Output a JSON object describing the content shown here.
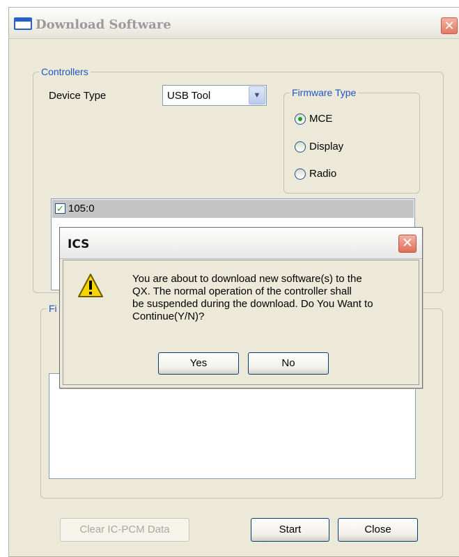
{
  "main_window": {
    "title": "Download Software",
    "close_glyph": "✕"
  },
  "controllers": {
    "legend": "Controllers",
    "device_type_label": "Device Type",
    "device_type_value": "USB Tool",
    "dropdown_glyph": "▼"
  },
  "firmware_type": {
    "legend": "Firmware Type",
    "options": [
      {
        "label": "MCE",
        "selected": true
      },
      {
        "label": "Display",
        "selected": false
      },
      {
        "label": "Radio",
        "selected": false
      }
    ]
  },
  "controller_list": {
    "items": [
      {
        "label": "105:0",
        "checked": true,
        "check_glyph": "✓"
      }
    ]
  },
  "files_group": {
    "legend_partial": "Fi"
  },
  "buttons": {
    "clear": "Clear IC-PCM Data",
    "start": "Start",
    "close": "Close"
  },
  "dialog": {
    "title": "ICS",
    "close_glyph": "✕",
    "icon": "warning-icon",
    "message": "You are about to download new software(s) to the\nQX. The normal operation of the controller shall\nbe suspended during the download. Do You Want to\nContinue(Y/N)?",
    "yes": "Yes",
    "no": "No"
  },
  "colors": {
    "group_legend": "#1f54c4",
    "window_bg": "#ece9d8",
    "radio_dot": "#21a121",
    "close_button": "#e27a66"
  }
}
